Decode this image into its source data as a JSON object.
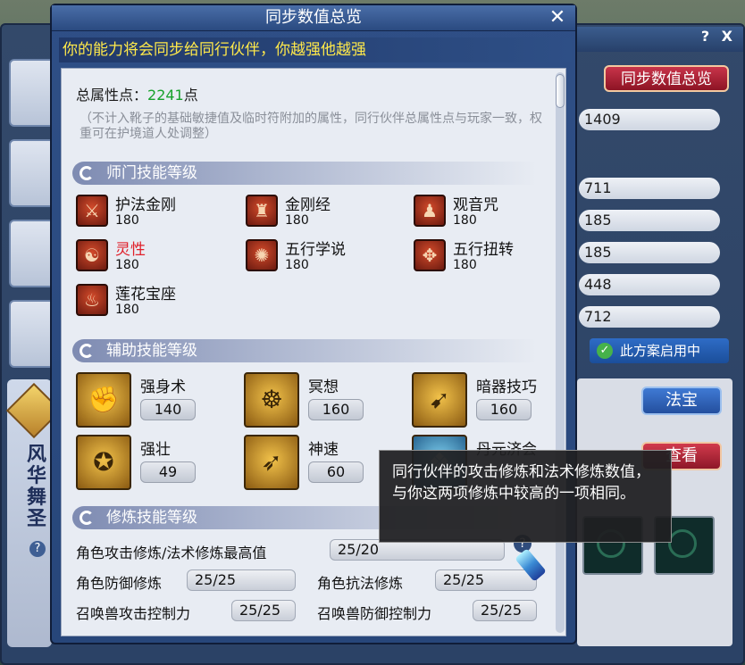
{
  "background": {
    "help_close": "? X",
    "sync_button": "同步数值总览",
    "values": [
      "1409",
      "711",
      "185",
      "185",
      "448",
      "712"
    ],
    "scheme_status": "此方案启用中",
    "fabao_button": "法宝",
    "view_button": "查看",
    "partner_name": "风华舞圣",
    "help_mark": "?"
  },
  "dialog": {
    "title": "同步数值总览",
    "close": "✕",
    "banner": "你的能力将会同步给同行伙伴，你越强他越强",
    "total_label": "总属性点：",
    "total_value": "2241",
    "total_unit": "点",
    "note": "（不计入靴子的基础敏捷值及临时符附加的属性，同行伙伴总属性点与玩家一致，权重可在护境道人处调整）"
  },
  "sections": {
    "school": "师门技能等级",
    "assist": "辅助技能等级",
    "cultivation": "修炼技能等级"
  },
  "school_skills": [
    {
      "name": "护法金刚",
      "level": "180",
      "icon": "guardian-icon",
      "glyph": "⚔"
    },
    {
      "name": "金刚经",
      "level": "180",
      "icon": "scripture-icon",
      "glyph": "♜"
    },
    {
      "name": "观音咒",
      "level": "180",
      "icon": "guanyin-icon",
      "glyph": "♟"
    },
    {
      "name": "灵性",
      "level": "180",
      "icon": "spirit-icon",
      "glyph": "☯"
    },
    {
      "name": "五行学说",
      "level": "180",
      "icon": "five-elements-icon",
      "glyph": "✺"
    },
    {
      "name": "五行扭转",
      "level": "180",
      "icon": "five-elements-twist-icon",
      "glyph": "✥"
    },
    {
      "name": "莲花宝座",
      "level": "180",
      "icon": "lotus-throne-icon",
      "glyph": "♨"
    }
  ],
  "assist_skills": [
    {
      "name": "强身术",
      "level": "140",
      "icon": "body-strengthening-icon",
      "glyph": "✊"
    },
    {
      "name": "冥想",
      "level": "160",
      "icon": "meditation-icon",
      "glyph": "☸"
    },
    {
      "name": "暗器技巧",
      "level": "160",
      "icon": "hidden-weapon-icon",
      "glyph": "➹"
    },
    {
      "name": "强壮",
      "level": "49",
      "icon": "strong-icon",
      "glyph": "✪"
    },
    {
      "name": "神速",
      "level": "60",
      "icon": "swiftness-icon",
      "glyph": "➶"
    },
    {
      "name": "丹元济会",
      "level": "",
      "icon": "elixir-icon",
      "glyph": "❖"
    }
  ],
  "cultivation": {
    "attack_label": "角色攻击修炼/法术修炼最高值",
    "attack_value": "25/20",
    "defense_label": "角色防御修炼",
    "defense_value": "25/25",
    "resist_label": "角色抗法修炼",
    "resist_value": "25/25",
    "pet_attack_label": "召唤兽攻击控制力",
    "pet_attack_value": "25/25",
    "pet_defense_label": "召唤兽防御控制力",
    "pet_defense_value": "25/25",
    "help_mark": "?"
  },
  "tooltip": "同行伙伴的攻击修炼和法术修炼数值，与你这两项修炼中较高的一项相同。",
  "colors": {
    "total_value": "#17a12b",
    "banner_text": "#ffe94a",
    "highlight_skill": "#e0202a"
  }
}
